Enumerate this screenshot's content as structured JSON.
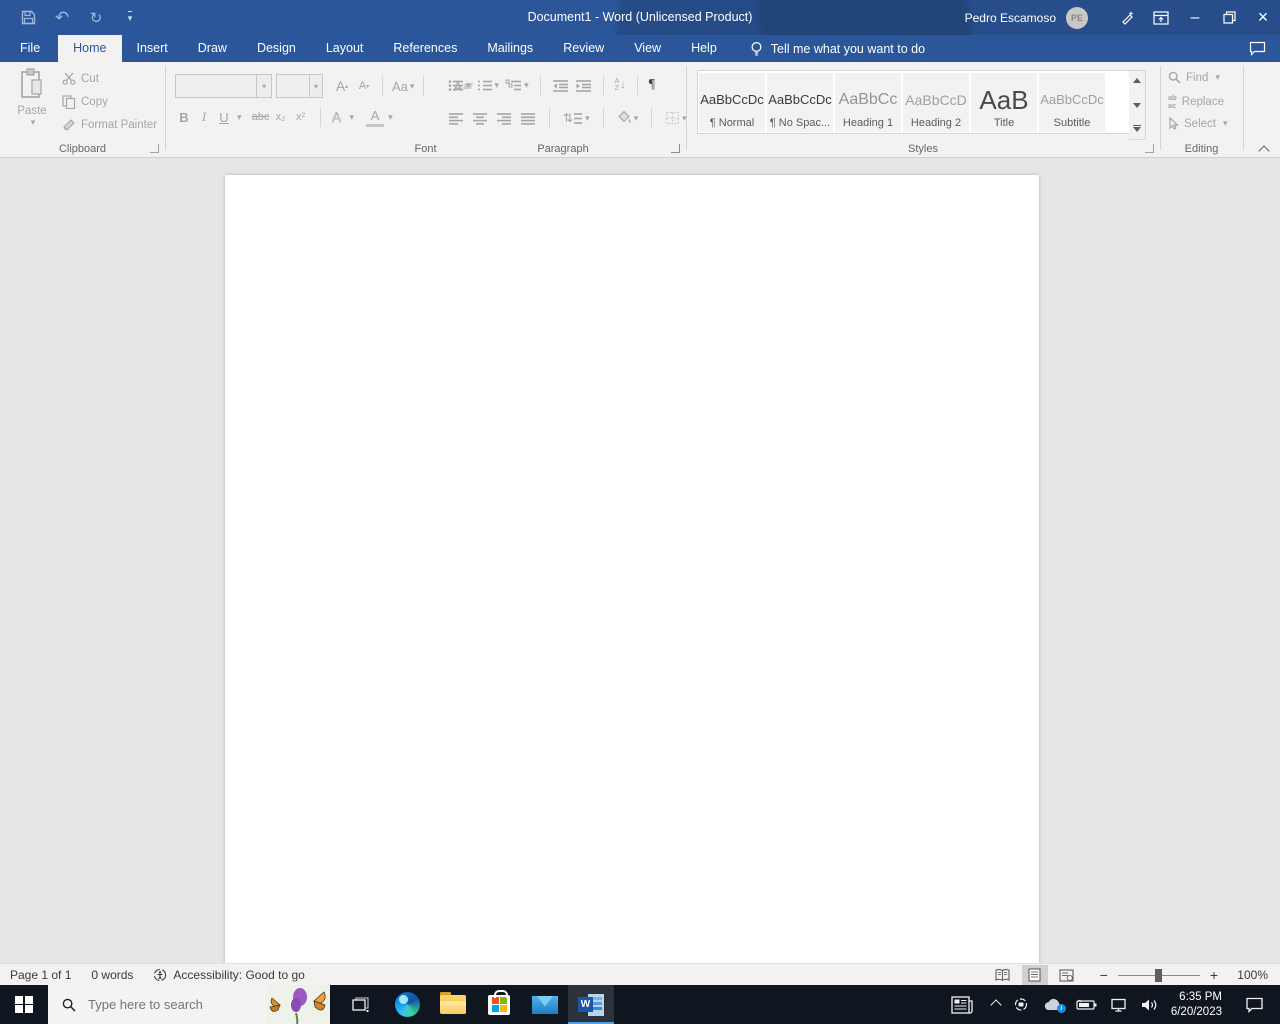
{
  "title_bar": {
    "title": "Document1  -  Word (Unlicensed Product)",
    "user_name": "Pedro Escamoso",
    "user_initials": "PE"
  },
  "glyphs": {
    "dropdown": "▾",
    "undo": "↶",
    "redo": "↻",
    "minimize": "–",
    "close": "×",
    "pilcrow": "¶",
    "updown": "⇅",
    "sort_arrow": "↓",
    "minus": "−",
    "plus": "+",
    "caret_up": "▴",
    "caret_down": "▾"
  },
  "ribbon_tabs": {
    "file": "File",
    "tabs": [
      "Home",
      "Insert",
      "Draw",
      "Design",
      "Layout",
      "References",
      "Mailings",
      "Review",
      "View",
      "Help"
    ],
    "active": "Home",
    "tell_me": "Tell me what you want to do"
  },
  "clipboard": {
    "label": "Clipboard",
    "paste": "Paste",
    "cut": "Cut",
    "copy": "Copy",
    "format_painter": "Format Painter"
  },
  "font": {
    "label": "Font",
    "name_value": "",
    "size_value": "",
    "bold": "B",
    "italic": "I",
    "underline": "U",
    "strikethrough": "abc",
    "subscript": "x₂",
    "superscript": "x²",
    "change_case": "Aa",
    "grow": "A",
    "shrink": "A",
    "effects": "A",
    "color": "A",
    "clear": "A"
  },
  "paragraph": {
    "label": "Paragraph",
    "sort_a": "A",
    "sort_z": "Z"
  },
  "styles": {
    "label": "Styles",
    "items": [
      {
        "preview": "AaBbCcDc",
        "name": "¶ Normal"
      },
      {
        "preview": "AaBbCcDc",
        "name": "¶ No Spac..."
      },
      {
        "preview": "AaBbCc",
        "name": "Heading 1"
      },
      {
        "preview": "AaBbCcD",
        "name": "Heading 2"
      },
      {
        "preview": "AaB",
        "name": "Title"
      },
      {
        "preview": "AaBbCcDc",
        "name": "Subtitle"
      }
    ]
  },
  "editing": {
    "label": "Editing",
    "find": "Find",
    "replace": "Replace",
    "select": "Select",
    "replace_icon_top": "ab",
    "replace_icon_bottom": "ac"
  },
  "status_bar": {
    "page": "Page 1 of 1",
    "words": "0 words",
    "accessibility": "Accessibility: Good to go",
    "zoom_level": "100%"
  },
  "taskbar": {
    "search_placeholder": "Type here to search",
    "time": "6:35 PM",
    "date": "6/20/2023"
  },
  "colors": {
    "accent": "#2b579a",
    "taskbar": "#10161f",
    "ribbon_bg": "#f3f2f1",
    "disabled": "#a8a6a4",
    "active_underline": "#4ca3e8"
  }
}
